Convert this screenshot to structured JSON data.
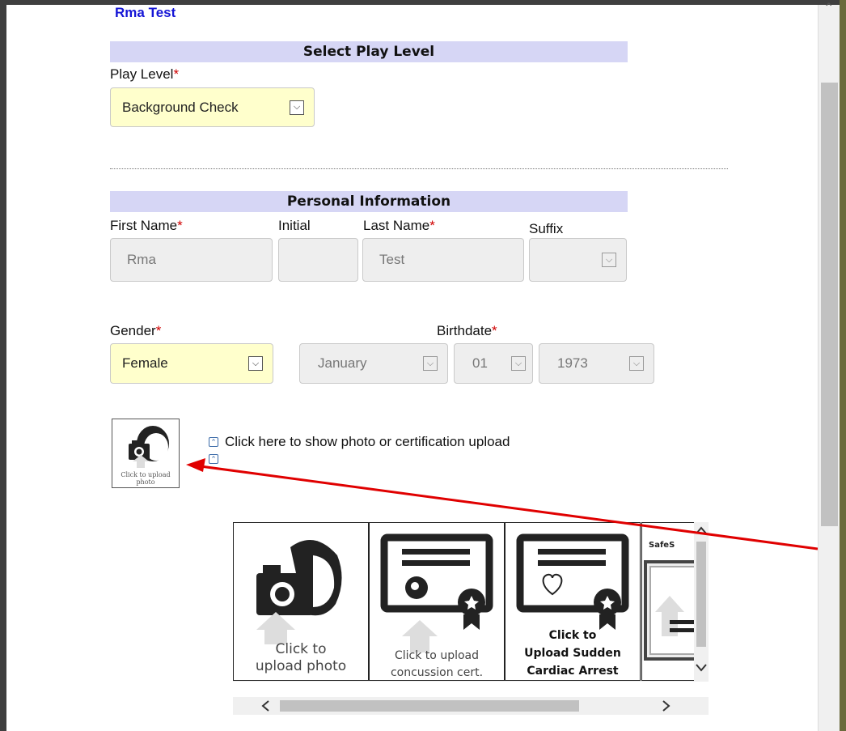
{
  "header": {
    "title": "Rma Test"
  },
  "play_level": {
    "section_title": "Select Play Level",
    "label": "Play Level",
    "value": "Background Check"
  },
  "personal": {
    "section_title": "Personal Information",
    "first_name_label": "First Name",
    "initial_label": "Initial",
    "last_name_label": "Last Name",
    "suffix_label": "Suffix",
    "first_name": "Rma",
    "initial": "",
    "last_name": "Test",
    "suffix": "",
    "gender_label": "Gender",
    "gender": "Female",
    "birthdate_label": "Birthdate",
    "birth_month": "January",
    "birth_day": "01",
    "birth_year": "1973"
  },
  "required_marker": "*",
  "photo": {
    "thumb_caption": "Click to upload photo",
    "toggle_text": "Click here to show photo or certification upload"
  },
  "uploads": {
    "tile1_line1": "Click to",
    "tile1_line2": "upload photo",
    "tile2_line1": "Click to upload",
    "tile2_line2": "concussion cert.",
    "tile3_line1": "Click to",
    "tile3_line2": "Upload Sudden",
    "tile3_line3": "Cardiac Arrest",
    "tile4_label": "SafeS"
  },
  "icons": {
    "dropdown": "chevron-down-icon",
    "toggle": "double-chevron-up-icon",
    "camera": "camera-icon",
    "certificate": "certificate-icon"
  },
  "colors": {
    "accent_blue": "#1515d6",
    "section_bar": "#d6d6f5",
    "required_red": "#d00000",
    "select_yellow": "#ffffcc",
    "annotation_arrow": "#e00000"
  }
}
